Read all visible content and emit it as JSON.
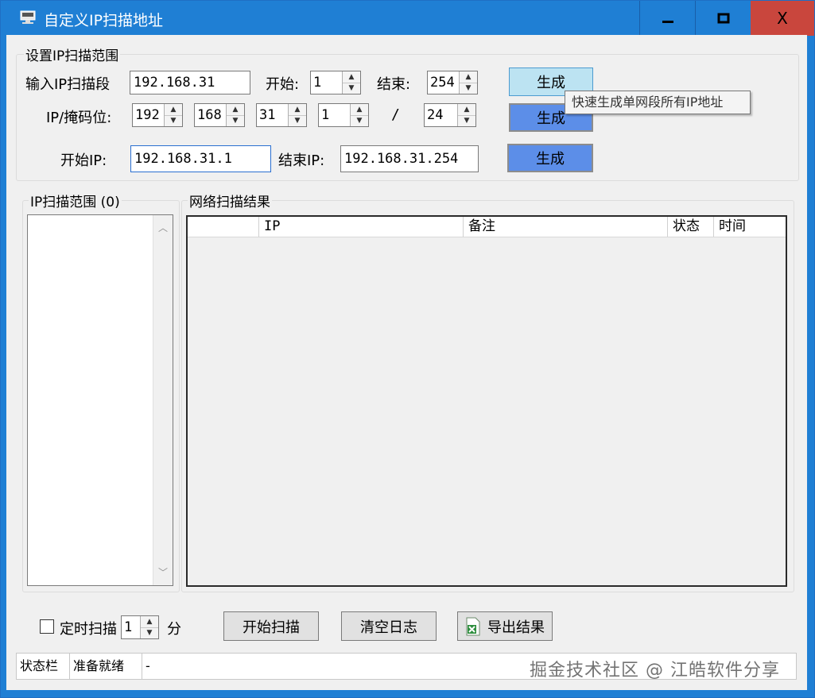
{
  "window": {
    "title": "自定义IP扫描地址",
    "controls": {
      "minimize": "▁",
      "maximize": "□",
      "close": "X"
    }
  },
  "range_group": {
    "label": "设置IP扫描范围",
    "segment_label": "输入IP扫描段",
    "segment_value": "192.168.31",
    "start_label": "开始:",
    "start_value": "1",
    "end_label": "结束:",
    "end_value": "254",
    "generate1": "生成",
    "mask_label": "IP/掩码位:",
    "octets": [
      "192",
      "168",
      "31",
      "1"
    ],
    "slash": "/",
    "mask_value": "24",
    "generate2": "生成",
    "start_ip_label": "开始IP:",
    "start_ip_value": "192.168.31.1",
    "end_ip_label": "结束IP:",
    "end_ip_value": "192.168.31.254",
    "generate3": "生成",
    "tooltip": "快速生成单网段所有IP地址"
  },
  "ip_list": {
    "label": "IP扫描范围 (0)"
  },
  "results": {
    "label": "网络扫描结果",
    "columns": [
      "",
      "IP",
      "备注",
      "状态",
      "时间"
    ]
  },
  "bottom": {
    "timer_label": "定时扫描",
    "timer_value": "1",
    "timer_unit": "分",
    "start_scan": "开始扫描",
    "clear_log": "清空日志",
    "export": "导出结果"
  },
  "statusbar": {
    "label": "状态栏",
    "status": "准备就绪",
    "detail": "-"
  },
  "watermark": "掘金技术社区 @ 江皓软件分享",
  "colors": {
    "titlebar": "#1f7fd4",
    "close_button": "#c9463d",
    "blue_button": "#5c8ee8",
    "hover_button": "#bce3f2"
  }
}
